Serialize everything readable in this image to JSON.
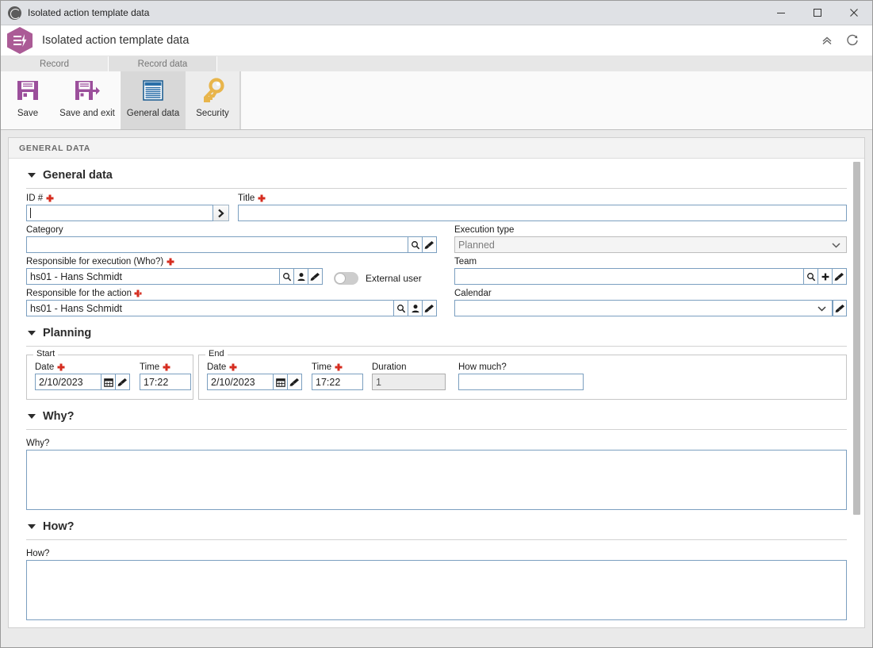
{
  "titlebar": {
    "title": "Isolated action template data",
    "icon": "globe-icon",
    "minimize": "minimize-icon",
    "maximize": "maximize-icon",
    "close": "close-icon"
  },
  "appheader": {
    "title": "Isolated action template data",
    "logo_color": "#ab5b96",
    "collapse_icon": "double-chevron-up-icon",
    "refresh_icon": "refresh-icon"
  },
  "ribbon": {
    "tabs": [
      {
        "label": "Record"
      },
      {
        "label": "Record data"
      }
    ],
    "groups": [
      {
        "buttons": [
          {
            "label": "Save",
            "icon": "floppy-disk-icon",
            "active": false
          },
          {
            "label": "Save and exit",
            "icon": "floppy-disk-arrow-icon",
            "active": false
          }
        ]
      },
      {
        "buttons": [
          {
            "label": "General data",
            "icon": "document-lines-icon",
            "active": true
          },
          {
            "label": "Security",
            "icon": "key-icon",
            "active": false
          }
        ]
      }
    ]
  },
  "panel": {
    "header": "GENERAL DATA"
  },
  "sections": {
    "general": {
      "title": "General data",
      "id": {
        "label": "ID #",
        "required": true,
        "value": "",
        "chevron_icon": "chevron-right-icon"
      },
      "title_field": {
        "label": "Title",
        "required": true,
        "value": ""
      },
      "category": {
        "label": "Category",
        "required": false,
        "value": "",
        "buttons": [
          "search-icon",
          "brush-icon"
        ]
      },
      "execution_type": {
        "label": "Execution type",
        "value": "Planned",
        "disabled": true,
        "options": [
          "Planned"
        ]
      },
      "responsible_execution": {
        "label": "Responsible for execution (Who?)",
        "required": true,
        "value": "hs01 - Hans Schmidt",
        "buttons": [
          "search-icon",
          "person-icon",
          "brush-icon"
        ]
      },
      "external_user": {
        "label": "External user",
        "checked": false
      },
      "team": {
        "label": "Team",
        "required": false,
        "value": "",
        "buttons": [
          "search-icon",
          "plus-icon",
          "brush-icon"
        ]
      },
      "responsible_action": {
        "label": "Responsible for the action",
        "required": true,
        "value": "hs01 - Hans Schmidt",
        "buttons": [
          "search-icon",
          "person-icon",
          "brush-icon"
        ]
      },
      "calendar": {
        "label": "Calendar",
        "value": "",
        "options": [],
        "buttons": [
          "brush-icon"
        ]
      }
    },
    "planning": {
      "title": "Planning",
      "start": {
        "legend": "Start",
        "date": {
          "label": "Date",
          "required": true,
          "value": "2/10/2023",
          "buttons": [
            "calendar-icon",
            "brush-icon"
          ]
        },
        "time": {
          "label": "Time",
          "required": true,
          "value": "17:22"
        }
      },
      "end": {
        "legend": "End",
        "date": {
          "label": "Date",
          "required": true,
          "value": "2/10/2023",
          "buttons": [
            "calendar-icon",
            "brush-icon"
          ]
        },
        "time": {
          "label": "Time",
          "required": true,
          "value": "17:22"
        },
        "duration": {
          "label": "Duration",
          "value": "1",
          "disabled": true
        },
        "how_much": {
          "label": "How much?",
          "value": ""
        }
      }
    },
    "why": {
      "title": "Why?",
      "field_label": "Why?",
      "value": ""
    },
    "how": {
      "title": "How?",
      "field_label": "How?",
      "value": ""
    }
  },
  "colors": {
    "accent_purple": "#ab5b96",
    "save_icon": "#8e44ad",
    "key_icon": "#e8b54b",
    "doc_icon": "#2a6fa8",
    "required_marker": "#d52b1e",
    "field_border": "#7b9fc0"
  }
}
